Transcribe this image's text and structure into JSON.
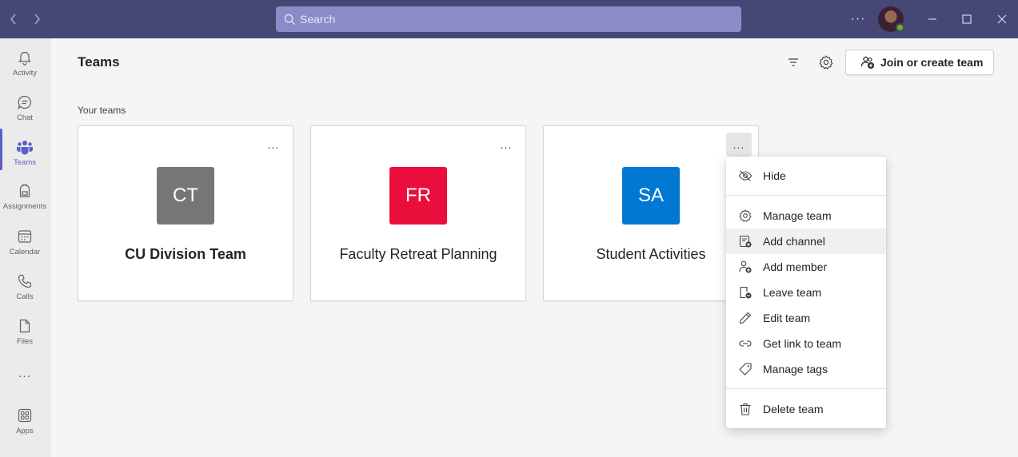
{
  "titlebar": {
    "search_placeholder": "Search"
  },
  "rail": {
    "items": [
      {
        "label": "Activity",
        "icon": "bell-icon"
      },
      {
        "label": "Chat",
        "icon": "chat-icon"
      },
      {
        "label": "Teams",
        "icon": "teams-icon",
        "active": true
      },
      {
        "label": "Assignments",
        "icon": "backpack-icon"
      },
      {
        "label": "Calendar",
        "icon": "calendar-icon"
      },
      {
        "label": "Calls",
        "icon": "phone-icon"
      },
      {
        "label": "Files",
        "icon": "file-icon"
      },
      {
        "label": "Apps",
        "icon": "apps-icon"
      }
    ],
    "more": "..."
  },
  "header": {
    "title": "Teams",
    "join_button": "Join or create team"
  },
  "section_label": "Your teams",
  "teams": [
    {
      "initials": "CT",
      "name": "CU Division Team",
      "color": "#767676",
      "bold": true
    },
    {
      "initials": "FR",
      "name": "Faculty Retreat Planning",
      "color": "#e90e3c"
    },
    {
      "initials": "SA",
      "name": "Student Activities",
      "color": "#0078d4"
    }
  ],
  "card_more": "...",
  "context_menu": {
    "items": [
      {
        "label": "Hide",
        "icon": "eye-off-icon"
      },
      {
        "label": "Manage team",
        "icon": "gear-icon"
      },
      {
        "label": "Add channel",
        "icon": "add-channel-icon",
        "hovered": true
      },
      {
        "label": "Add member",
        "icon": "add-member-icon"
      },
      {
        "label": "Leave team",
        "icon": "leave-team-icon"
      },
      {
        "label": "Edit team",
        "icon": "pencil-icon"
      },
      {
        "label": "Get link to team",
        "icon": "link-icon"
      },
      {
        "label": "Manage tags",
        "icon": "tag-icon"
      },
      {
        "label": "Delete team",
        "icon": "trash-icon"
      }
    ]
  },
  "colors": {
    "titlebar": "#464775",
    "accent": "#5b5fc7",
    "search_bg": "#8b8cc7"
  }
}
